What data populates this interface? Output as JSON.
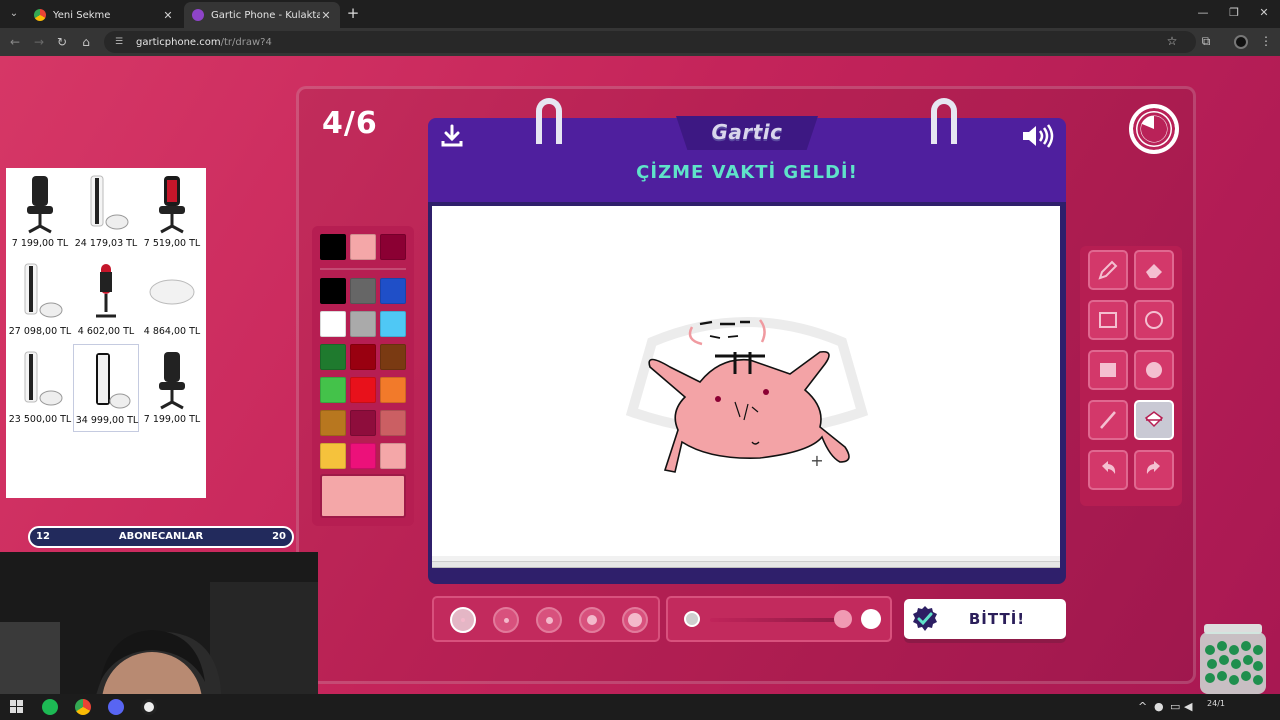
{
  "browser": {
    "tabs": [
      {
        "title": "Yeni Sekme",
        "close": "✕"
      },
      {
        "title": "Gartic Phone - Kulaktan Kulağa",
        "close": "✕"
      }
    ],
    "new_tab": "+",
    "url_host": "garticphone.com",
    "url_path": "/tr/draw?4"
  },
  "game": {
    "round": "4/6",
    "logo": "Gartic",
    "instruction": "ÇİZME VAKTİ GELDİ!",
    "done_label": "BİTTİ!",
    "palette": {
      "top_row": [
        "#000000",
        "#f4a7a8",
        "#8b0033"
      ],
      "grid": [
        "#000000",
        "#666666",
        "#1f4fc8",
        "#ffffff",
        "#aaaaaa",
        "#4fc8f5",
        "#1f7a2e",
        "#990010",
        "#7a3a12",
        "#44c24a",
        "#e8111b",
        "#f27a2a",
        "#b8771f",
        "#8e0d3c",
        "#cb5f63",
        "#f5c23c",
        "#ec117a",
        "#f4a7a8"
      ],
      "current": "#f4a7a8"
    },
    "tools": [
      {
        "name": "pencil-tool",
        "active": false
      },
      {
        "name": "eraser-tool",
        "active": false
      },
      {
        "name": "rectangle-outline-tool",
        "active": false
      },
      {
        "name": "ellipse-outline-tool",
        "active": false
      },
      {
        "name": "rectangle-filled-tool",
        "active": false
      },
      {
        "name": "ellipse-filled-tool",
        "active": false
      },
      {
        "name": "line-tool",
        "active": false
      },
      {
        "name": "fill-bucket-tool",
        "active": true
      },
      {
        "name": "undo-tool",
        "active": false
      },
      {
        "name": "redo-tool",
        "active": false
      }
    ],
    "brush_size_selected": 1,
    "opacity": 1.0
  },
  "overlay": {
    "products": [
      {
        "price": "7 199,00 TL",
        "kind": "chair"
      },
      {
        "price": "24 179,03 TL",
        "kind": "console"
      },
      {
        "price": "7 519,00 TL",
        "kind": "chair-red"
      },
      {
        "price": "27 098,00 TL",
        "kind": "console"
      },
      {
        "price": "4 602,00 TL",
        "kind": "microphone"
      },
      {
        "price": "4 864,00 TL",
        "kind": "mouse"
      },
      {
        "price": "23 500,00 TL",
        "kind": "console"
      },
      {
        "price": "34 999,00 TL",
        "kind": "console-dark"
      },
      {
        "price": "7 199,00 TL",
        "kind": "chair"
      }
    ],
    "sub_goal": {
      "left": "12",
      "label": "ABONECANLAR",
      "right": "20"
    }
  },
  "taskbar": {
    "clock": "24/1"
  }
}
